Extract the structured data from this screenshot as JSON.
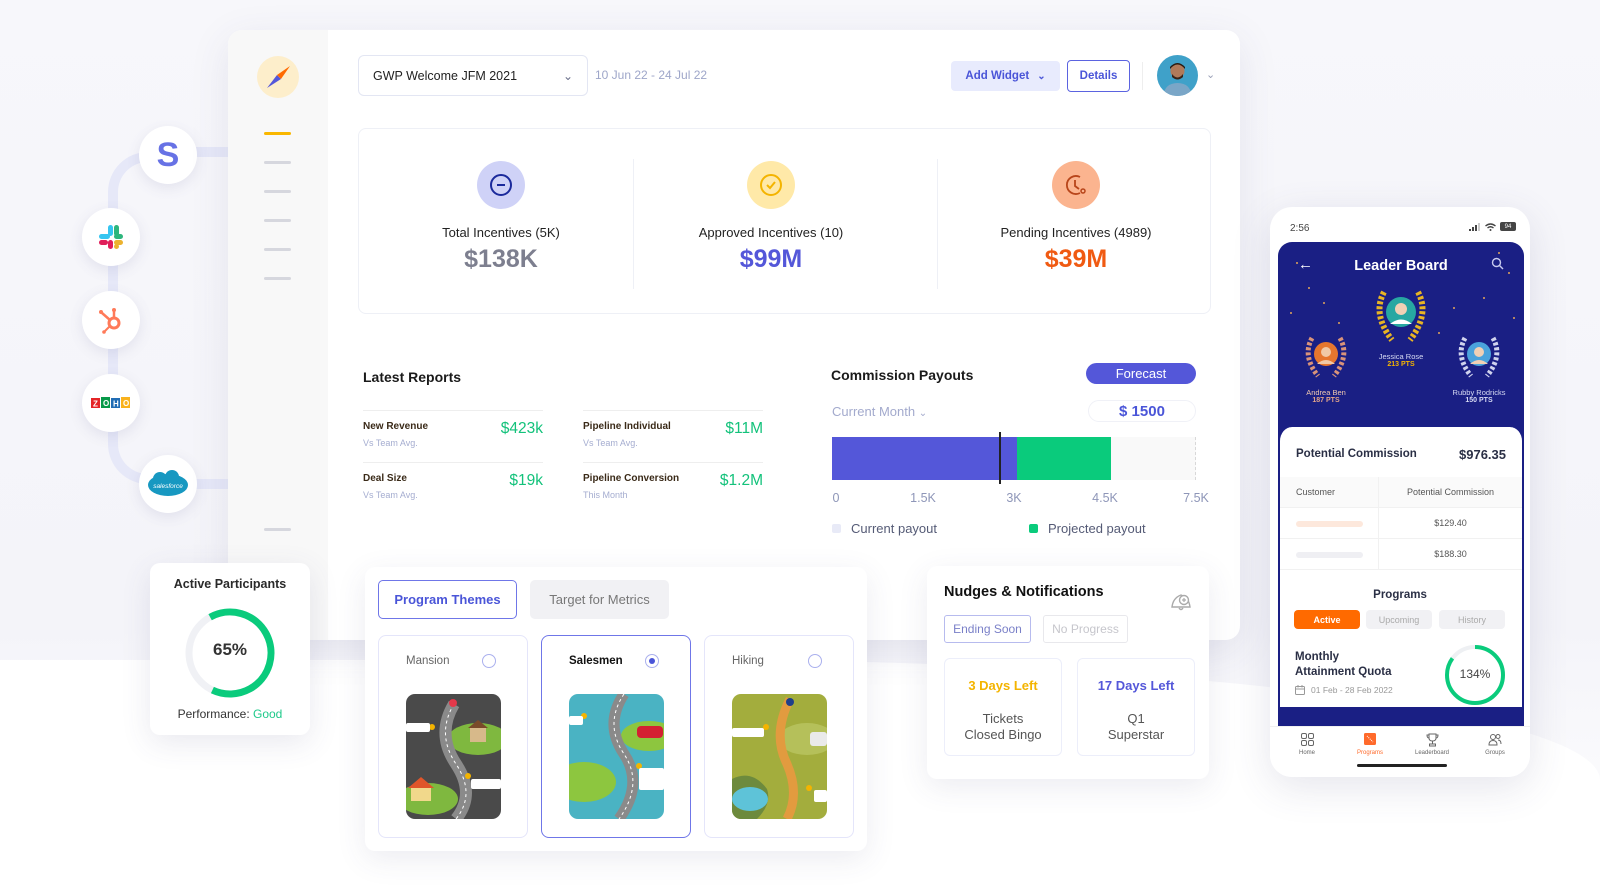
{
  "header": {
    "program_select": "GWP Welcome JFM 2021",
    "date_range": "10 Jun 22 - 24 Jul 22",
    "add_widget_label": "Add Widget",
    "details_label": "Details"
  },
  "sidebar": {
    "items": [
      "nav-item-1",
      "nav-item-2",
      "nav-item-3",
      "nav-item-4",
      "nav-item-5",
      "nav-item-6",
      "nav-item-bottom"
    ],
    "active_index": 0
  },
  "integrations": [
    {
      "name": "Stripe",
      "glyph": "S"
    },
    {
      "name": "Slack",
      "glyph": "slack"
    },
    {
      "name": "HubSpot",
      "glyph": "hubspot"
    },
    {
      "name": "Zoho",
      "glyph": "ZOHO"
    },
    {
      "name": "Salesforce",
      "glyph": "salesforce"
    }
  ],
  "stats": [
    {
      "label": "Total Incentives (5K)",
      "value": "$138K",
      "icon": "minus-circle-icon",
      "color": "#7d7f8f",
      "bg": "#cfd2f7",
      "stroke": "#1b2a9c"
    },
    {
      "label": "Approved Incentives (10)",
      "value": "$99M",
      "icon": "check-circle-icon",
      "color": "#5457d9",
      "bg": "#ffe9a8",
      "stroke": "#f4b400"
    },
    {
      "label": "Pending Incentives (4989)",
      "value": "$39M",
      "icon": "clock-icon",
      "color": "#f05a12",
      "bg": "#fbb48f",
      "stroke": "#b8451a"
    }
  ],
  "latest_reports": {
    "title": "Latest Reports",
    "items": [
      {
        "name": "New Revenue",
        "sub": "Vs Team Avg.",
        "value": "$423k"
      },
      {
        "name": "Pipeline Individual",
        "sub": "Vs Team Avg.",
        "value": "$11M"
      },
      {
        "name": "Deal Size",
        "sub": "Vs Team Avg.",
        "value": "$19k"
      },
      {
        "name": "Pipeline Conversion",
        "sub": "This Month",
        "value": "$1.2M"
      }
    ]
  },
  "commission_payouts": {
    "title": "Commission Payouts",
    "forecast_label": "Forecast",
    "period_label": "Current Month",
    "amount": "$ 1500",
    "legend": [
      {
        "label": "Current payout",
        "color": "#e8eaf7"
      },
      {
        "label": "Projected payout",
        "color": "#0acb7c"
      }
    ]
  },
  "chart_data": {
    "type": "bar",
    "orientation": "horizontal-stacked",
    "title": "Commission Payouts",
    "categories": [
      "Current Month"
    ],
    "series": [
      {
        "name": "Current payout",
        "values": [
          3050
        ],
        "color": "#5457d9"
      },
      {
        "name": "Projected payout",
        "values": [
          1550
        ],
        "color": "#0acb7c"
      }
    ],
    "marker_value": 2750,
    "xlim": [
      0,
      6000
    ],
    "tick_labels": [
      "0",
      "1.5K",
      "3K",
      "4.5K",
      "7.5K"
    ],
    "tick_values": [
      0,
      1500,
      3000,
      4500,
      6000
    ],
    "legend_position": "bottom"
  },
  "active_participants": {
    "title": "Active Participants",
    "percent": 65,
    "percent_label": "65%",
    "performance_label": "Performance:",
    "performance_value": "Good"
  },
  "program_themes": {
    "tabs": [
      {
        "label": "Program Themes",
        "active": true
      },
      {
        "label": "Target for Metrics",
        "active": false
      }
    ],
    "themes": [
      {
        "name": "Mansion",
        "selected": false
      },
      {
        "name": "Salesmen",
        "selected": true
      },
      {
        "name": "Hiking",
        "selected": false
      }
    ]
  },
  "nudges": {
    "title": "Nudges & Notifications",
    "filters": [
      {
        "label": "Ending Soon",
        "active": true
      },
      {
        "label": "No Progress",
        "active": false
      }
    ],
    "items": [
      {
        "days": "3 Days Left",
        "desc1": "Tickets",
        "desc2": "Closed Bingo",
        "color": "#f4b400"
      },
      {
        "days": "17 Days Left",
        "desc1": "Q1",
        "desc2": "Superstar",
        "color": "#5457d9"
      }
    ]
  },
  "phone": {
    "time": "2:56",
    "battery": "94",
    "leaderboard_title": "Leader Board",
    "winners": [
      {
        "name": "Andrea Ben",
        "points": "187 PTS",
        "rank": 2
      },
      {
        "name": "Jessica Rose",
        "points": "213 PTS",
        "rank": 1
      },
      {
        "name": "Rubby Rodricks",
        "points": "150 PTS",
        "rank": 3
      }
    ],
    "potential_commission_label": "Potential Commission",
    "potential_commission_value": "$976.35",
    "table_headers": [
      "Customer",
      "Potential Commission"
    ],
    "table_rows": [
      {
        "customer": "",
        "value": "$129.40"
      },
      {
        "customer": "",
        "value": "$188.30"
      }
    ],
    "programs_title": "Programs",
    "program_tabs": [
      {
        "label": "Active",
        "active": true
      },
      {
        "label": "Upcoming",
        "active": false
      },
      {
        "label": "History",
        "active": false
      }
    ],
    "quota_line1": "Monthly",
    "quota_line2": "Attainment Quota",
    "quota_dates": "01 Feb - 28 Feb 2022",
    "quota_percent": 134,
    "quota_label": "134%",
    "tabbar": [
      "Home",
      "Programs",
      "Leaderboard",
      "Groups"
    ],
    "tabbar_active": 1
  }
}
